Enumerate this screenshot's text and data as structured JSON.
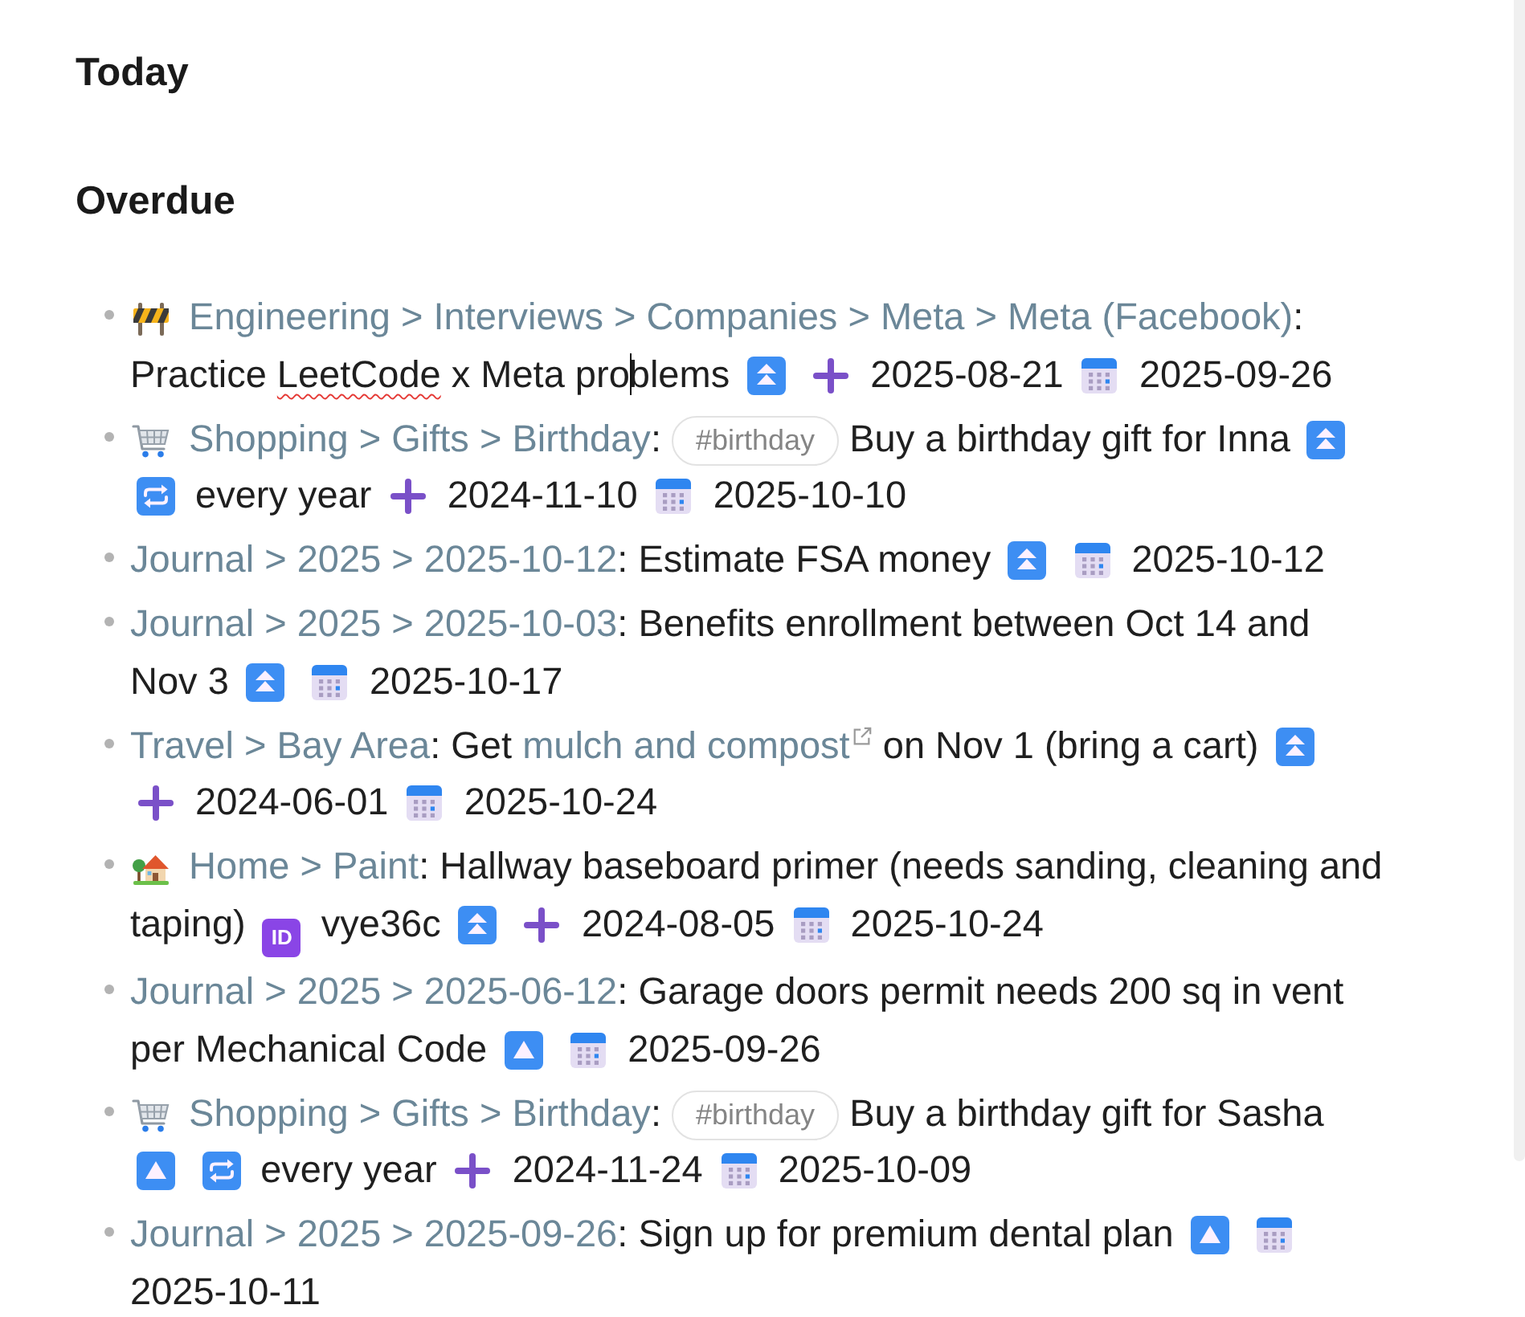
{
  "sections": [
    {
      "title": "Today"
    },
    {
      "title": "Overdue",
      "tasks": [
        {
          "kind": "construction",
          "path": "Engineering > Interviews > Companies > Meta > Meta (Facebook)",
          "colon": ":",
          "description": [
            {
              "kind": "text",
              "text": "Practice "
            },
            {
              "kind": "misspelled",
              "text": "LeetCode"
            },
            {
              "kind": "text",
              "text": " x Meta pro"
            },
            {
              "kind": "caret"
            },
            {
              "kind": "text",
              "text": "blems"
            }
          ],
          "fields": [
            {
              "kind": "priority_high"
            },
            {
              "kind": "created",
              "text": "2025-08-21"
            },
            {
              "kind": "due",
              "text": "2025-09-26"
            }
          ]
        },
        {
          "kind": "shopping",
          "path": "Shopping > Gifts > Birthday",
          "colon": ":",
          "tag": "#birthday",
          "description": [
            {
              "kind": "text",
              "text": "Buy a birthday gift for Inna"
            }
          ],
          "fields": [
            {
              "kind": "priority_high"
            },
            {
              "kind": "recurrence",
              "text": "every year"
            },
            {
              "kind": "created",
              "text": "2024-11-10"
            },
            {
              "kind": "due",
              "text": "2025-10-10"
            }
          ]
        },
        {
          "kind": "plain",
          "path": "Journal > 2025 > 2025-10-12",
          "colon": ":",
          "description": [
            {
              "kind": "text",
              "text": "Estimate FSA money"
            }
          ],
          "fields": [
            {
              "kind": "priority_high"
            },
            {
              "kind": "due",
              "text": "2025-10-12"
            }
          ]
        },
        {
          "kind": "plain",
          "path": "Journal > 2025 > 2025-10-03",
          "colon": ":",
          "description": [
            {
              "kind": "text",
              "text": "Benefits enrollment between Oct 14 and Nov 3"
            }
          ],
          "fields": [
            {
              "kind": "priority_high"
            },
            {
              "kind": "due",
              "text": "2025-10-17"
            }
          ]
        },
        {
          "kind": "plain",
          "path": "Travel > Bay Area",
          "colon": ":",
          "description": [
            {
              "kind": "text",
              "text": "Get "
            },
            {
              "kind": "link",
              "text": "mulch and compost"
            },
            {
              "kind": "text",
              "text": " on Nov 1 (bring a cart)"
            }
          ],
          "fields": [
            {
              "kind": "priority_high"
            },
            {
              "kind": "created",
              "text": "2024-06-01"
            },
            {
              "kind": "due",
              "text": "2025-10-24"
            }
          ]
        },
        {
          "kind": "home",
          "path": "Home > Paint",
          "colon": ":",
          "description": [
            {
              "kind": "text",
              "text": "Hallway baseboard primer (needs sanding, cleaning and taping)"
            }
          ],
          "fields": [
            {
              "kind": "id",
              "symbol": "ID",
              "text": "vye36c"
            },
            {
              "kind": "priority_high"
            },
            {
              "kind": "created",
              "text": "2024-08-05"
            },
            {
              "kind": "due",
              "text": "2025-10-24"
            }
          ]
        },
        {
          "kind": "plain",
          "path": "Journal > 2025 > 2025-06-12",
          "colon": ":",
          "description": [
            {
              "kind": "text",
              "text": "Garage doors permit needs 200 sq in vent per Mechanical Code"
            }
          ],
          "fields": [
            {
              "kind": "priority_medium"
            },
            {
              "kind": "due",
              "text": "2025-09-26"
            }
          ]
        },
        {
          "kind": "shopping",
          "path": "Shopping > Gifts > Birthday",
          "colon": ":",
          "tag": "#birthday",
          "description": [
            {
              "kind": "text",
              "text": "Buy a birthday gift for Sasha"
            }
          ],
          "fields": [
            {
              "kind": "priority_medium"
            },
            {
              "kind": "recurrence",
              "text": "every year"
            },
            {
              "kind": "created",
              "text": "2024-11-24"
            },
            {
              "kind": "due",
              "text": "2025-10-09"
            }
          ]
        },
        {
          "kind": "plain",
          "path": "Journal > 2025 > 2025-09-26",
          "colon": ":",
          "description": [
            {
              "kind": "text",
              "text": "Sign up for premium dental plan"
            }
          ],
          "fields": [
            {
              "kind": "priority_medium"
            },
            {
              "kind": "due",
              "text": "2025-10-11"
            }
          ]
        }
      ]
    }
  ]
}
